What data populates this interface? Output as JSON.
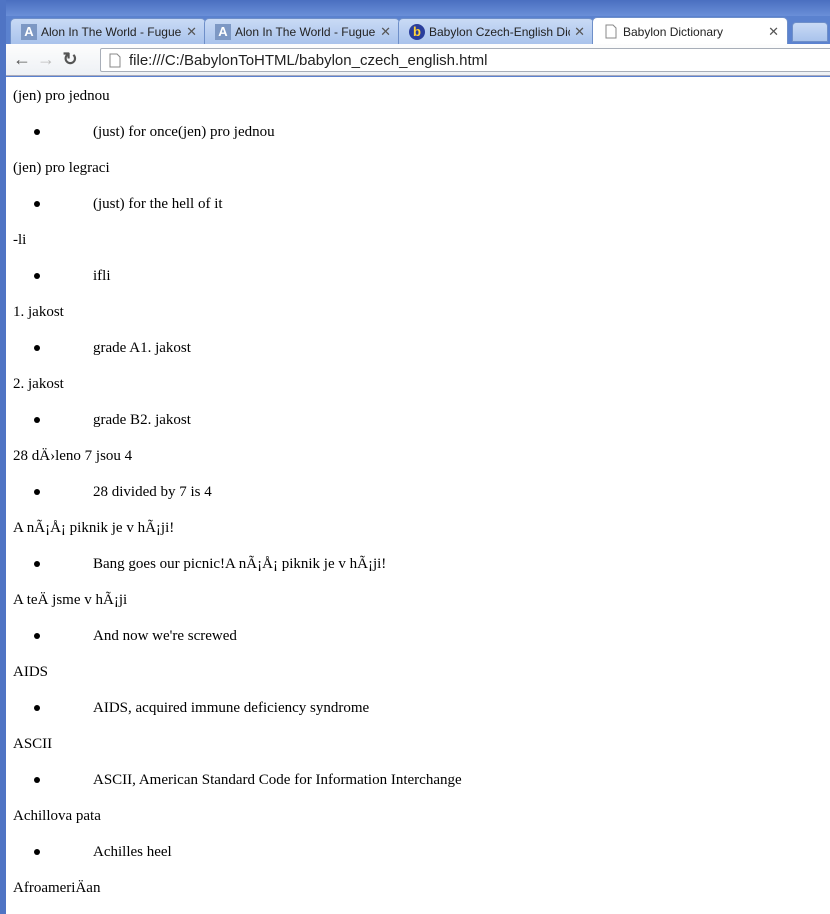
{
  "browser": {
    "tabs": [
      {
        "label": "Alon In The World - Fugue",
        "icon": "letter-a-icon"
      },
      {
        "label": "Alon In The World - Fugue",
        "icon": "letter-a-icon"
      },
      {
        "label": "Babylon Czech-English Dic",
        "icon": "babylon-b-icon"
      },
      {
        "label": "Babylon Dictionary",
        "icon": "page-icon",
        "active": true
      }
    ],
    "address": "file:///C:/BabylonToHTML/babylon_czech_english.html"
  },
  "entries": [
    {
      "term": "(jen) pro jednou",
      "definition": "(just) for once(jen) pro jednou"
    },
    {
      "term": "(jen) pro legraci",
      "definition": "(just) for the hell of it"
    },
    {
      "term": "-li",
      "definition": "ifli"
    },
    {
      "term": "1. jakost",
      "definition": "grade A1. jakost"
    },
    {
      "term": "2. jakost",
      "definition": "grade B2. jakost"
    },
    {
      "term": "28 dÄ›leno 7 jsou 4",
      "definition": "28 divided by 7 is 4"
    },
    {
      "term": "A nÃ¡Å¡ piknik je v hÃ¡ji!",
      "definition": "Bang goes our picnic!A nÃ¡Å¡ piknik je v hÃ¡ji!"
    },
    {
      "term": "A teÄ jsme v hÃ¡ji",
      "definition": "And now we're screwed"
    },
    {
      "term": "AIDS",
      "definition": "AIDS, acquired immune deficiency syndrome"
    },
    {
      "term": "ASCII",
      "definition": "ASCII, American Standard Code for Information Interchange"
    },
    {
      "term": "Achillova pata",
      "definition": "Achilles heel"
    },
    {
      "term": "AfroameriÄan",
      "definition": null
    }
  ]
}
